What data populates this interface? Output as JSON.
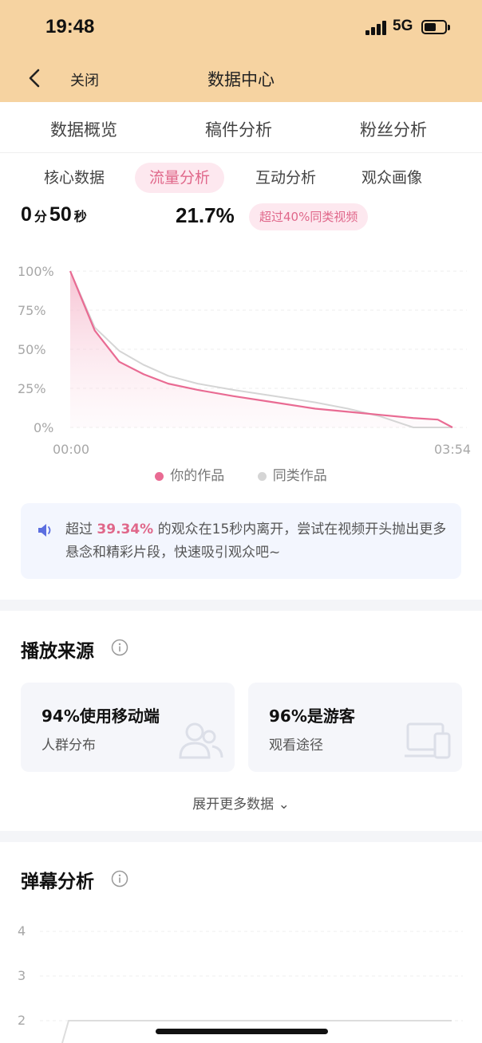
{
  "status": {
    "time": "19:48",
    "network": "5G"
  },
  "nav": {
    "close_label": "关闭",
    "title": "数据中心"
  },
  "main_tabs": [
    {
      "label": "数据概览"
    },
    {
      "label": "稿件分析"
    },
    {
      "label": "粉丝分析"
    }
  ],
  "sub_tabs": [
    {
      "label": "核心数据",
      "active": false
    },
    {
      "label": "流量分析",
      "active": true
    },
    {
      "label": "互动分析",
      "active": false
    },
    {
      "label": "观众画像",
      "active": false
    }
  ],
  "metrics": {
    "duration_min": "0",
    "duration_min_unit": "分",
    "duration_sec": "50",
    "duration_sec_unit": "秒",
    "retention_percent": "21.7%",
    "badge": "超过40%同类视频"
  },
  "chart_data": {
    "type": "area",
    "x_labels": [
      "00:00",
      "03:54"
    ],
    "x_range_seconds": [
      0,
      234
    ],
    "y_ticks": [
      "100%",
      "75%",
      "50%",
      "25%",
      "0%"
    ],
    "ylim": [
      0,
      100
    ],
    "grid": true,
    "legend_position": "bottom",
    "series": [
      {
        "name": "你的作品",
        "color": "#e96b93",
        "x": [
          0,
          15,
          30,
          45,
          60,
          78,
          100,
          125,
          150,
          170,
          190,
          210,
          225,
          234
        ],
        "values": [
          100,
          62,
          42,
          34,
          28,
          24,
          20,
          16,
          12,
          10,
          8,
          6,
          5,
          0
        ]
      },
      {
        "name": "同类作品",
        "color": "#d5d5d5",
        "x": [
          0,
          15,
          30,
          45,
          60,
          78,
          100,
          125,
          150,
          170,
          190,
          210,
          225,
          234
        ],
        "values": [
          100,
          64,
          49,
          40,
          33,
          28,
          24,
          20,
          16,
          12,
          7,
          0,
          0,
          0
        ]
      }
    ]
  },
  "tip": {
    "prefix": "超过",
    "highlight": "39.34%",
    "suffix": "的观众在15秒内离开，尝试在视频开头抛出更多悬念和精彩片段，快速吸引观众吧~"
  },
  "play_source": {
    "title": "播放来源",
    "cards": [
      {
        "main": "94%使用移动端",
        "sub": "人群分布",
        "icon": "users-icon"
      },
      {
        "main": "96%是游客",
        "sub": "观看途径",
        "icon": "devices-icon"
      }
    ],
    "expand_label": "展开更多数据 ⌄"
  },
  "danmu": {
    "title": "弹幕分析",
    "y_ticks": [
      "4",
      "3",
      "2"
    ]
  }
}
